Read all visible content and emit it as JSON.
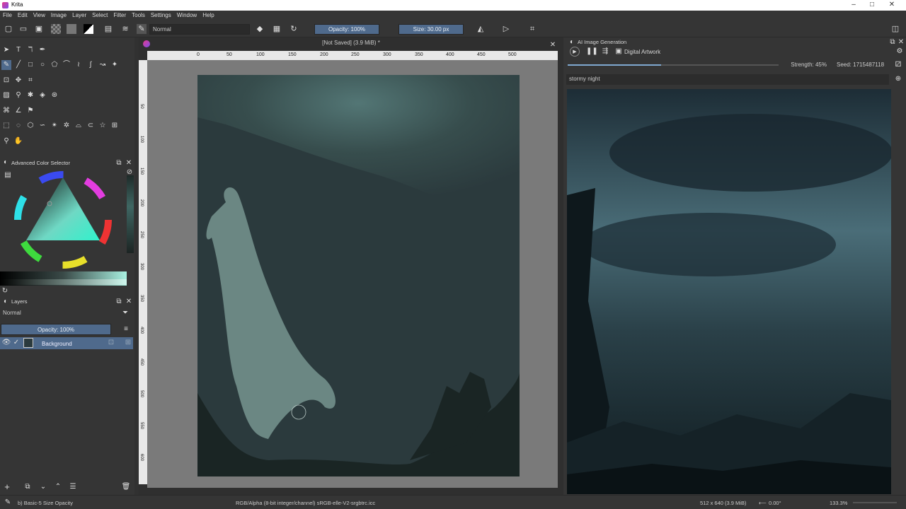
{
  "app": {
    "title": "Krita"
  },
  "menu": [
    "File",
    "Edit",
    "View",
    "Image",
    "Layer",
    "Select",
    "Filter",
    "Tools",
    "Settings",
    "Window",
    "Help"
  ],
  "toolbar": {
    "blend_mode": "Normal",
    "opacity": "Opacity: 100%",
    "size": "Size: 30.00 px"
  },
  "document": {
    "title": "[Not Saved]  (3.9 MiB) *"
  },
  "ruler": {
    "h_ticks": [
      "0",
      "50",
      "100",
      "150",
      "200",
      "250",
      "300",
      "350",
      "400",
      "450",
      "500"
    ],
    "v_ticks": [
      "50",
      "100",
      "150",
      "200",
      "250",
      "300",
      "350",
      "400",
      "450",
      "500",
      "550",
      "600"
    ]
  },
  "color_selector": {
    "title": "Advanced Color Selector"
  },
  "layers": {
    "title": "Layers",
    "blend_mode": "Normal",
    "opacity": "Opacity:  100%",
    "items": [
      {
        "name": "Background"
      }
    ]
  },
  "ai_panel": {
    "title": "AI Image Generation",
    "style": "Digital Artwork",
    "strength": "Strength: 45%",
    "seed": "Seed: 1715487118",
    "prompt": "stormy night"
  },
  "status": {
    "brush": "b) Basic-5 Size Opacity",
    "color_space": "RGB/Alpha (8-bit integer/channel)  sRGB-elle-V2-srgbtrc.icc",
    "dimensions": "512 x 640 (3.9 MiB)",
    "rotation": "0.00°",
    "zoom": "133.3%"
  },
  "colors": {
    "accent": "#4f6a8c",
    "panel": "#353535",
    "canvas_bg": "#2b3a3d"
  }
}
